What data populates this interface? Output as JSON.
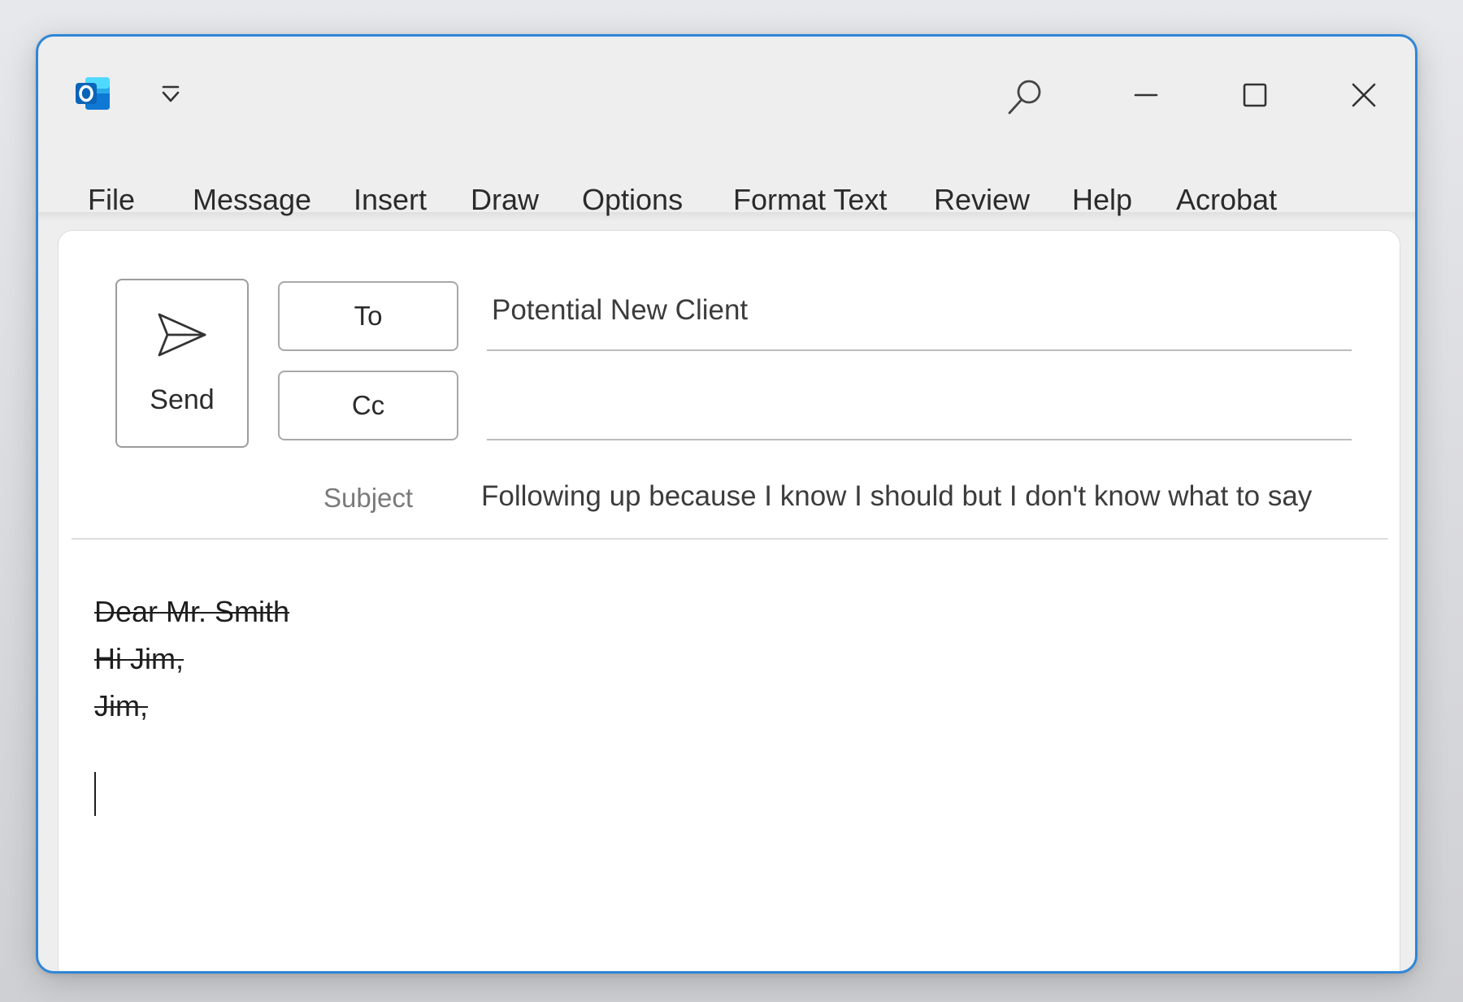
{
  "app": {
    "name": "Outlook",
    "icon": "outlook-icon",
    "accent_color": "#2f86d6"
  },
  "titlebar": {
    "quick_access_icon": "customize-quick-access-icon",
    "search_icon": "search-icon",
    "minimize_icon": "minimize-icon",
    "maximize_icon": "maximize-icon",
    "close_icon": "close-icon"
  },
  "menu": {
    "items": [
      {
        "label": "File"
      },
      {
        "label": "Message"
      },
      {
        "label": "Insert"
      },
      {
        "label": "Draw"
      },
      {
        "label": "Options"
      },
      {
        "label": "Format Text"
      },
      {
        "label": "Review"
      },
      {
        "label": "Help"
      },
      {
        "label": "Acrobat"
      }
    ]
  },
  "compose": {
    "send_label": "Send",
    "send_icon": "send-icon",
    "to_label": "To",
    "cc_label": "Cc",
    "to_value": "Potential New Client",
    "cc_value": "",
    "subject_label": "Subject",
    "subject_value": "Following up because I know I should but I don't know what to say"
  },
  "body": {
    "lines": [
      {
        "text": "Dear Mr. Smith",
        "strikethrough": true
      },
      {
        "text": "Hi Jim,",
        "strikethrough": true
      },
      {
        "text": "Jim,",
        "strikethrough": true
      }
    ],
    "text_color": "#1e1e1e"
  },
  "scrollbar": {
    "left_icon": "scroll-left-icon",
    "right_icon": "scroll-right-icon"
  }
}
